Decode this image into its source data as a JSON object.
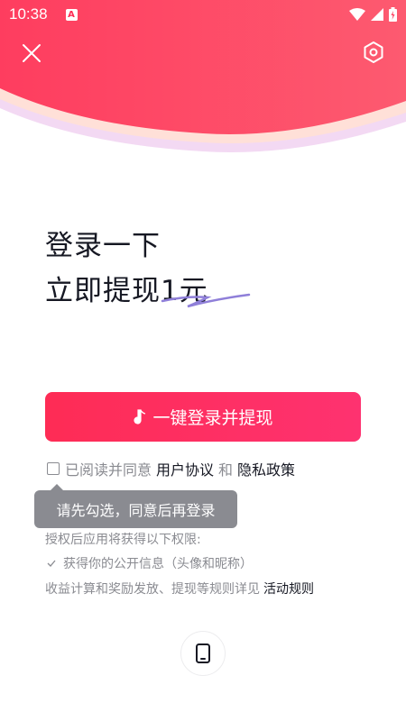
{
  "status_bar": {
    "time": "10:38",
    "app_badge": "A"
  },
  "colors": {
    "brand": "#fe2c55",
    "muted_text": "#8a8b91",
    "tooltip_bg": "#8a8b91"
  },
  "headline": {
    "line1": "登录一下",
    "line2": "立即提现1元"
  },
  "login_button": {
    "icon": "music-note-icon",
    "label": "一键登录并提现"
  },
  "agreement": {
    "prefix": "已阅读并同意",
    "user_agreement": "用户协议",
    "conjunction": "和",
    "privacy_policy": "隐私政策"
  },
  "tooltip": {
    "text": "请先勾选，同意后再登录"
  },
  "permissions": {
    "title": "授权后应用将获得以下权限:",
    "items": [
      "获得你的公开信息（头像和昵称）"
    ]
  },
  "rules": {
    "text": "收益计算和奖励发放、提现等规则详见",
    "link": "活动规则"
  },
  "alt_login": {
    "icon": "phone-icon"
  }
}
